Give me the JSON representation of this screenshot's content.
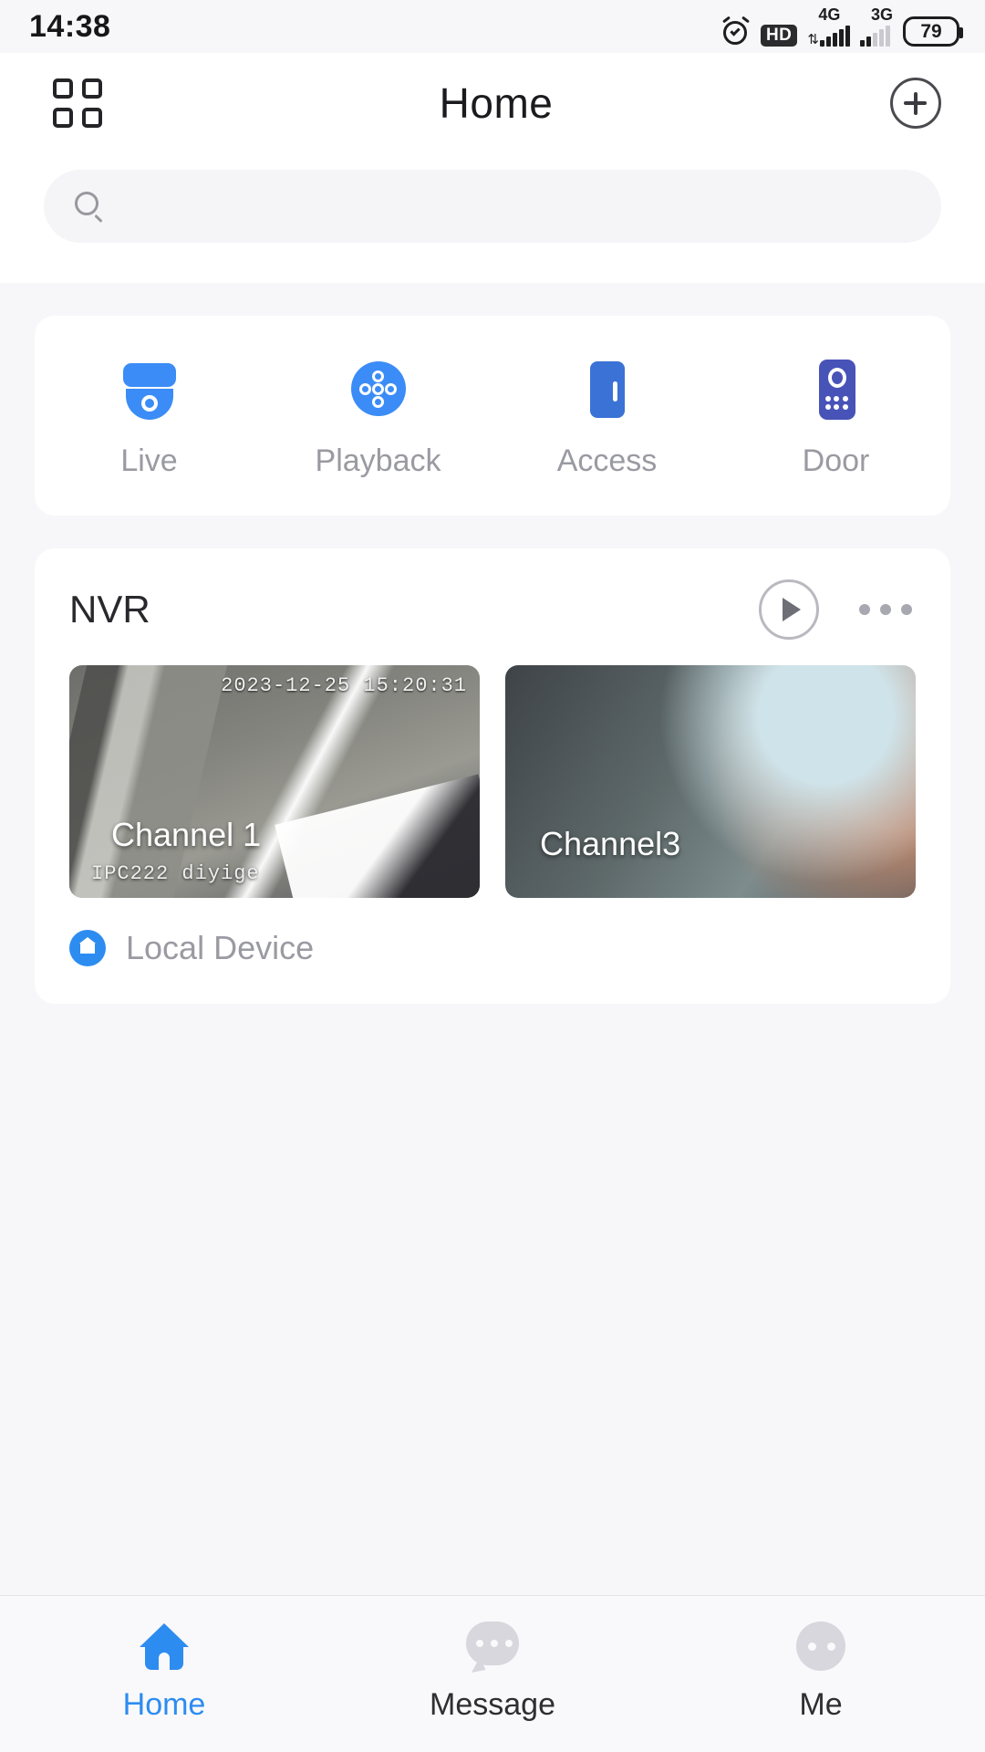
{
  "status_bar": {
    "time": "14:38",
    "alarm_icon": "alarm-clock-icon",
    "hd_badge": "HD",
    "network_primary": "4G",
    "network_secondary": "3G",
    "battery_percent": "79"
  },
  "header": {
    "grid_icon": "grid-menu-icon",
    "title": "Home",
    "add_icon": "plus-circle-icon"
  },
  "search": {
    "icon": "search-icon",
    "value": "",
    "placeholder": ""
  },
  "quick_actions": [
    {
      "label": "Live",
      "icon": "dome-camera-icon",
      "color": "#3b8cf6"
    },
    {
      "label": "Playback",
      "icon": "playback-dots-icon",
      "color": "#3b8cf6"
    },
    {
      "label": "Access",
      "icon": "door-access-icon",
      "color": "#3b72d6"
    },
    {
      "label": "Door",
      "icon": "intercom-panel-icon",
      "color": "#4853b8"
    }
  ],
  "device_card": {
    "title": "NVR",
    "play_icon": "play-circle-icon",
    "more_icon": "more-horizontal-icon",
    "channels": [
      {
        "name": "Channel 1",
        "timestamp": "2023-12-25 15:20:31",
        "osd_text": "IPC222 diyige"
      },
      {
        "name": "Channel3",
        "timestamp": "",
        "osd_text": ""
      }
    ],
    "footer": {
      "badge_icon": "home-badge-icon",
      "label": "Local Device"
    }
  },
  "tab_bar": {
    "active": "Home",
    "accent_color": "#2d8cf0",
    "items": [
      {
        "label": "Home",
        "icon": "home-icon"
      },
      {
        "label": "Message",
        "icon": "message-bubble-icon"
      },
      {
        "label": "Me",
        "icon": "profile-icon"
      }
    ]
  }
}
